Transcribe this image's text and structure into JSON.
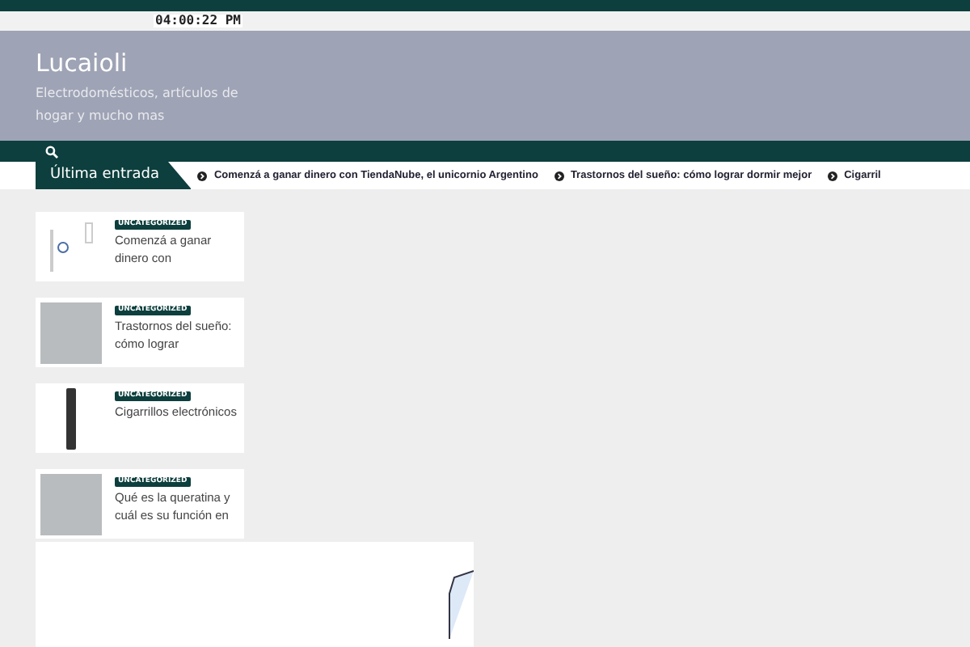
{
  "top_bar": {
    "time": "04:00:22 PM"
  },
  "header": {
    "site_title": "Lucaioli",
    "tagline": "Electrodomésticos, artículos de hogar y mucho mas"
  },
  "ticker": {
    "label": "Última entrada",
    "items": [
      "Comenzá a ganar dinero con TiendaNube, el unicornio Argentino",
      "Trastornos del sueño: cómo lograr dormir mejor",
      "Cigarril"
    ]
  },
  "posts": [
    {
      "category": "UNCATEGORIZED",
      "title": "Comenzá a ganar dinero con",
      "kind": "logo"
    },
    {
      "category": "UNCATEGORIZED",
      "title": "Trastornos del sueño: cómo lograr",
      "kind": "photo"
    },
    {
      "category": "UNCATEGORIZED",
      "title": "Cigarrillos electrónicos",
      "kind": "device"
    },
    {
      "category": "UNCATEGORIZED",
      "title": "Qué es la queratina y cuál es su función en",
      "kind": "photo"
    }
  ]
}
